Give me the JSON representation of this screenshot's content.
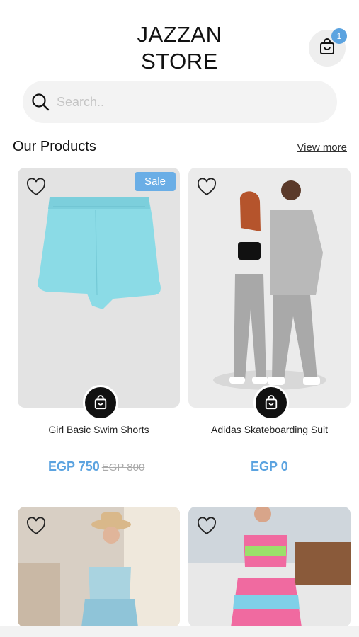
{
  "header": {
    "brand_line1": "JAZZAN",
    "brand_line2": "STORE",
    "cart_count": "1"
  },
  "search": {
    "placeholder": "Search.."
  },
  "section": {
    "title": "Our Products",
    "view_more": "View more"
  },
  "products": [
    {
      "name": "Girl Basic Swim Shorts",
      "price": "EGP 750",
      "old_price": "EGP 800",
      "badge": "Sale"
    },
    {
      "name": "Adidas Skateboarding Suit",
      "price": "EGP 0"
    },
    {
      "name": ""
    },
    {
      "name": ""
    }
  ],
  "colors": {
    "accent": "#5ba3e0",
    "sale_badge": "#6aaee6"
  },
  "icons": {
    "cart": "shopping-bag-icon",
    "search": "search-icon",
    "favorite": "heart-icon"
  }
}
